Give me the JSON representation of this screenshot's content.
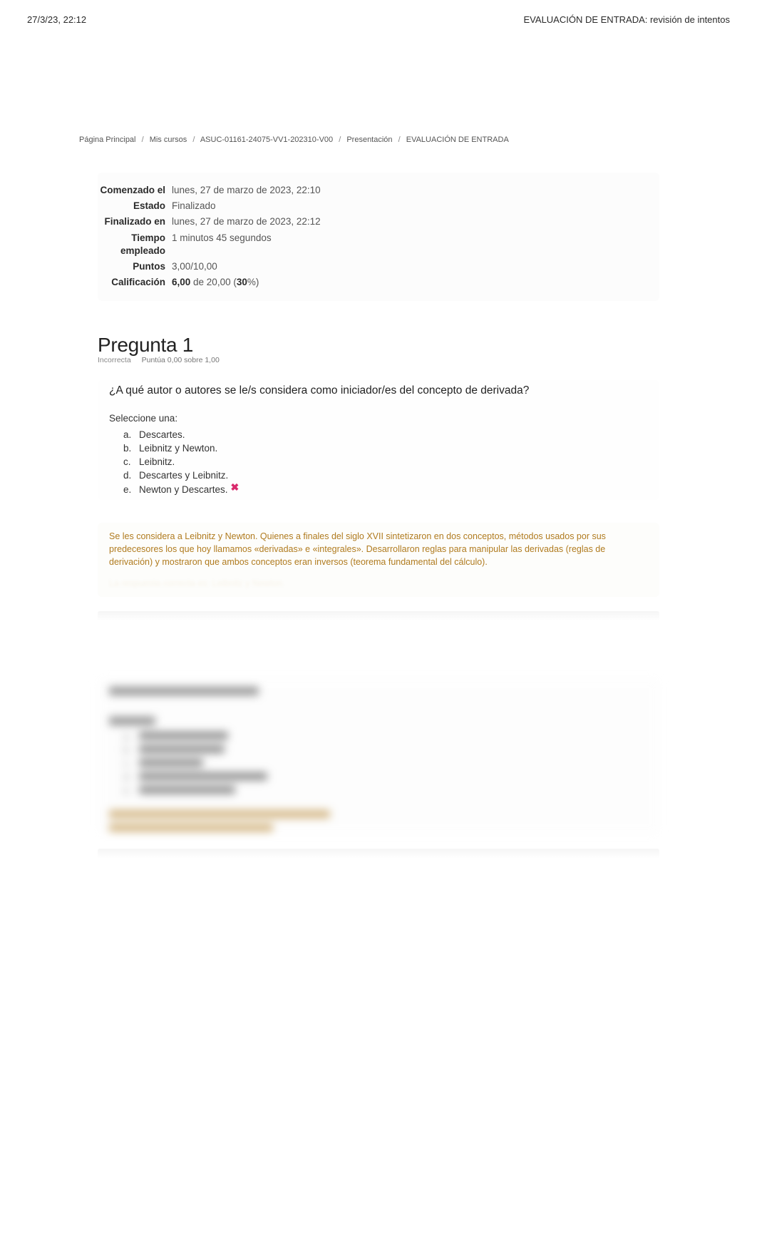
{
  "print_header": {
    "left": "27/3/23, 22:12",
    "right": "EVALUACIÓN DE ENTRADA: revisión de intentos"
  },
  "breadcrumb": {
    "items": [
      "Página Principal",
      "Mis cursos",
      "ASUC-01161-24075-VV1-202310-V00",
      "Presentación",
      "EVALUACIÓN DE ENTRADA"
    ],
    "sep": "/"
  },
  "summary": {
    "rows": [
      {
        "label": "Comenzado el",
        "value": "lunes, 27 de marzo de 2023, 22:10"
      },
      {
        "label": "Estado",
        "value": "Finalizado"
      },
      {
        "label": "Finalizado en",
        "value": "lunes, 27 de marzo de 2023, 22:12"
      },
      {
        "label": "Tiempo empleado",
        "value": "1 minutos 45 segundos"
      },
      {
        "label": "Puntos",
        "value": "3,00/10,00"
      }
    ],
    "grade_label": "Calificación",
    "grade_bold1": "6,00",
    "grade_mid": " de 20,00 (",
    "grade_bold2": "30",
    "grade_tail": "%)"
  },
  "q1": {
    "title": "Pregunta 1",
    "status": "Incorrecta",
    "score": "Puntúa 0,00 sobre 1,00",
    "text": "¿A qué autor o autores se le/s considera como iniciador/es del concepto de derivada?",
    "select": "Seleccione una:",
    "options": [
      {
        "letter": "a.",
        "text": "Descartes."
      },
      {
        "letter": "b.",
        "text": "Leibnitz y Newton."
      },
      {
        "letter": "c.",
        "text": "Leibnitz."
      },
      {
        "letter": "d.",
        "text": "Descartes y Leibnitz."
      },
      {
        "letter": "e.",
        "text": "Newton y Descartes."
      }
    ],
    "wrong_mark": "✖",
    "feedback": "Se les considera a Leibnitz y Newton. Quienes a finales del siglo XVII sintetizaron en dos conceptos, métodos usados por sus predecesores los que hoy llamamos «derivadas» e «integrales». Desarrollaron reglas para manipular las derivadas (reglas de derivación) y mostraron que ambos conceptos eran inversos (teorema fundamental del cálculo).",
    "feedback_answer": "La respuesta correcta es: Leibnitz y Newton."
  }
}
